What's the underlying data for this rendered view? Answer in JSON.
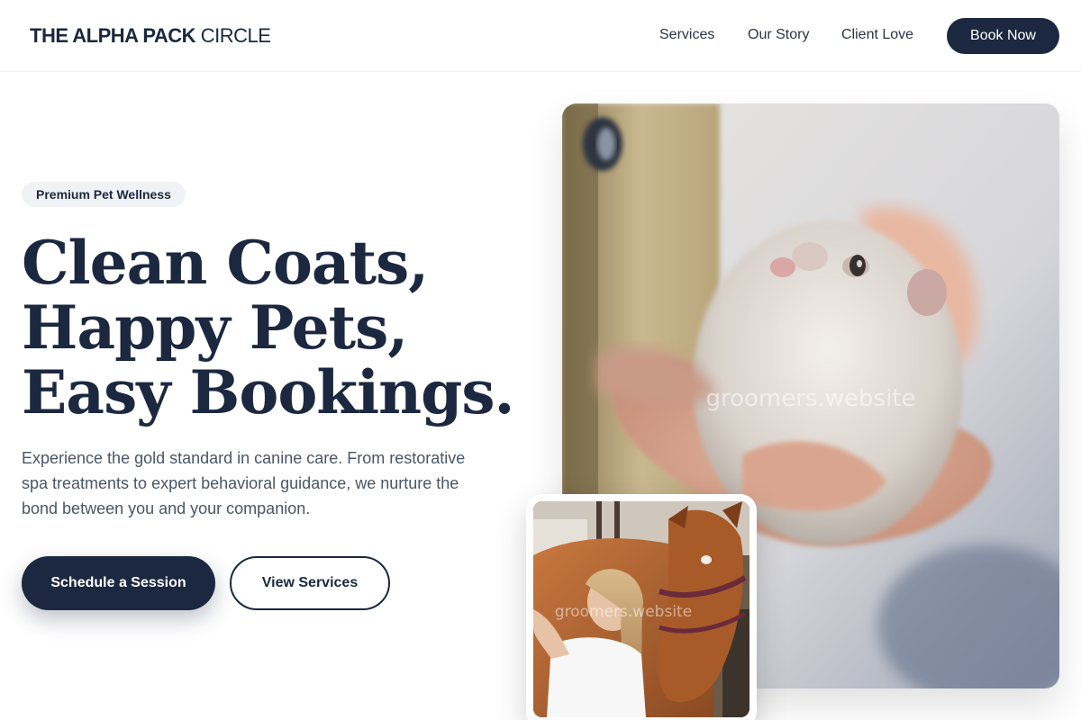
{
  "header": {
    "logo_bold": "THE ALPHA PACK",
    "logo_light": "CIRCLE",
    "nav": [
      "Services",
      "Our Story",
      "Client Love"
    ],
    "book_label": "Book Now"
  },
  "hero": {
    "badge": "Premium Pet Wellness",
    "headline": [
      "Clean Coats,",
      "Happy Pets,",
      "Easy Bookings."
    ],
    "description": "Experience the gold standard in canine care. From restorative spa treatments to expert behavioral guidance, we nurture the bond between you and your companion.",
    "primary_cta": "Schedule a Session",
    "secondary_cta": "View Services"
  },
  "images": {
    "main_watermark": "groomers.website",
    "small_watermark": "groomers.website"
  },
  "colors": {
    "navy": "#1c2840",
    "badge_bg": "#f0f2f5",
    "body_text": "#4a5568"
  }
}
